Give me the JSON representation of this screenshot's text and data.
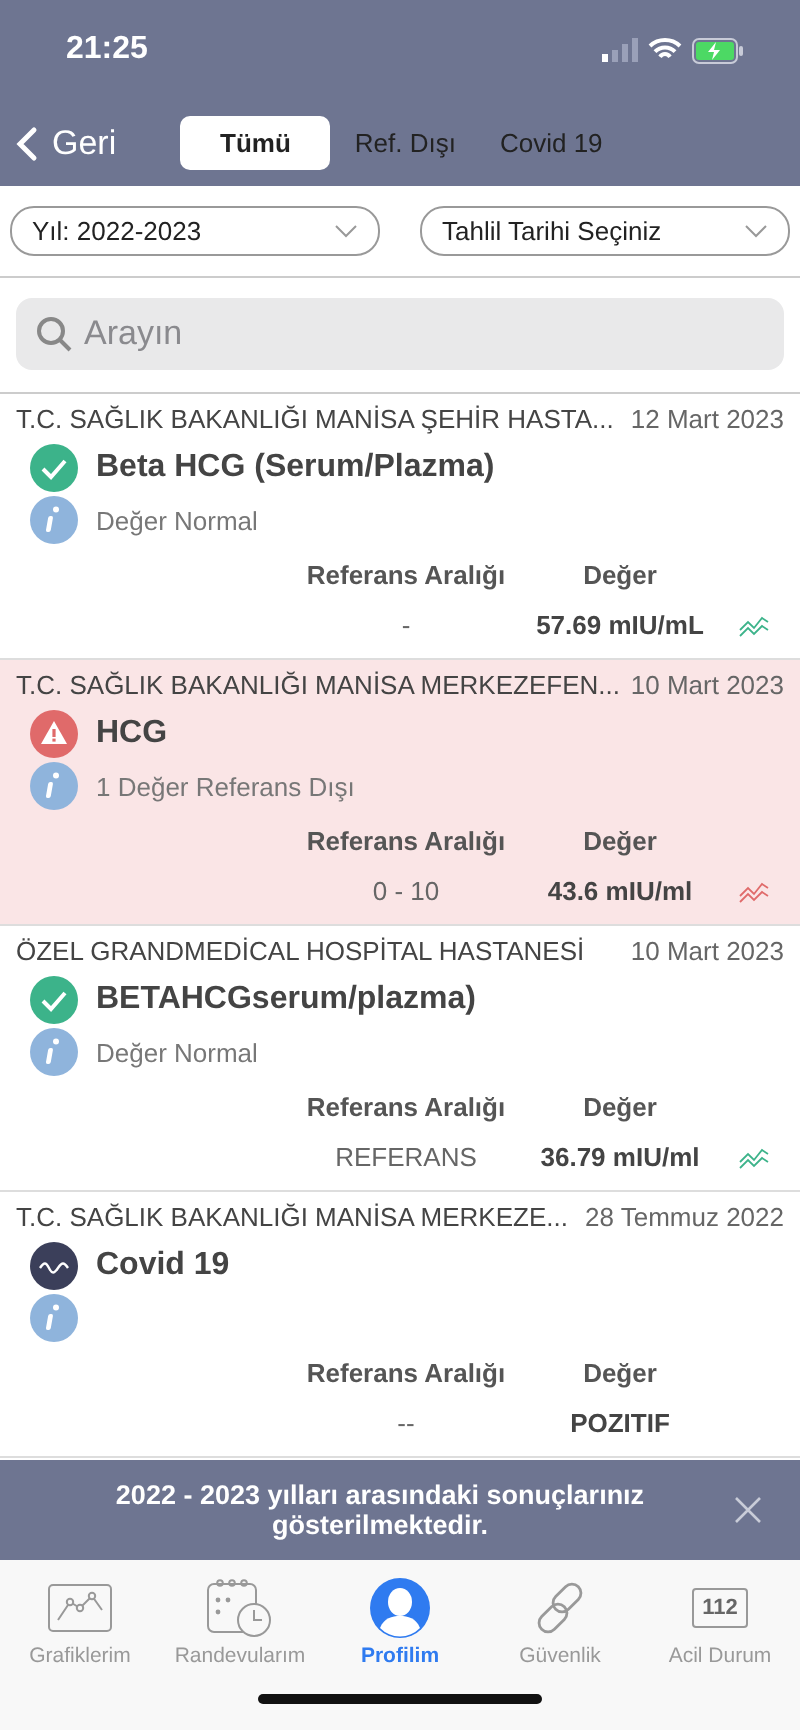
{
  "status_bar": {
    "time": "21:25"
  },
  "nav": {
    "back": "Geri",
    "tabs": [
      {
        "label": "Tümü",
        "selected": true
      },
      {
        "label": "Ref. Dışı",
        "selected": false
      },
      {
        "label": "Covid 19",
        "selected": false
      }
    ]
  },
  "filters": [
    {
      "value": "Yıl: 2022-2023"
    },
    {
      "value": "Tahlil Tarihi Seçiniz"
    }
  ],
  "search": {
    "placeholder": "Arayın"
  },
  "results": [
    {
      "hospital": "T.C. SAĞLIK BAKANLIĞI MANİSA ŞEHİR HASTA...",
      "date": "12 Mart 2023",
      "kind": "normal",
      "test": "Beta HCG (Serum/Plazma)",
      "info": "Değer Normal",
      "range_label": "Referans Aralığı",
      "value_label": "Değer",
      "range": "-",
      "value": "57.69 mIU/mL"
    },
    {
      "hospital": "T.C. SAĞLIK BAKANLIĞI MANİSA MERKEZEFEN...",
      "date": "10 Mart 2023",
      "kind": "abnormal",
      "test": "HCG",
      "info": "1 Değer Referans Dışı",
      "range_label": "Referans Aralığı",
      "value_label": "Değer",
      "range": "0 - 10",
      "value": "43.6 mIU/ml"
    },
    {
      "hospital": "ÖZEL GRANDMEDİCAL HOSPİTAL HASTANESİ",
      "date": "10 Mart 2023",
      "kind": "normal",
      "test": "BETAHCGserum/plazma)",
      "info": "Değer Normal",
      "range_label": "Referans Aralığı",
      "value_label": "Değer",
      "range": "REFERANS",
      "value": "36.79 mIU/ml"
    },
    {
      "hospital": "T.C. SAĞLIK BAKANLIĞI MANİSA MERKEZE...",
      "date": "28 Temmuz 2022",
      "kind": "covid",
      "test": "Covid 19",
      "range_label": "Referans Aralığı",
      "value_label": "Değer",
      "range": "--",
      "value": "POZITIF"
    }
  ],
  "banner": {
    "message": "2022 - 2023 yılları arasındaki sonuçlarınız gösterilmektedir."
  },
  "tab_bar": [
    {
      "label": "Grafiklerim",
      "kind": "chart",
      "selected": false
    },
    {
      "label": "Randevularım",
      "kind": "calendar",
      "selected": false
    },
    {
      "label": "Profilim",
      "kind": "profile",
      "selected": true
    },
    {
      "label": "Güvenlik",
      "kind": "link",
      "selected": false
    },
    {
      "label": "Acil Durum",
      "kind": "emergency",
      "icon_text": "112",
      "selected": false
    }
  ]
}
